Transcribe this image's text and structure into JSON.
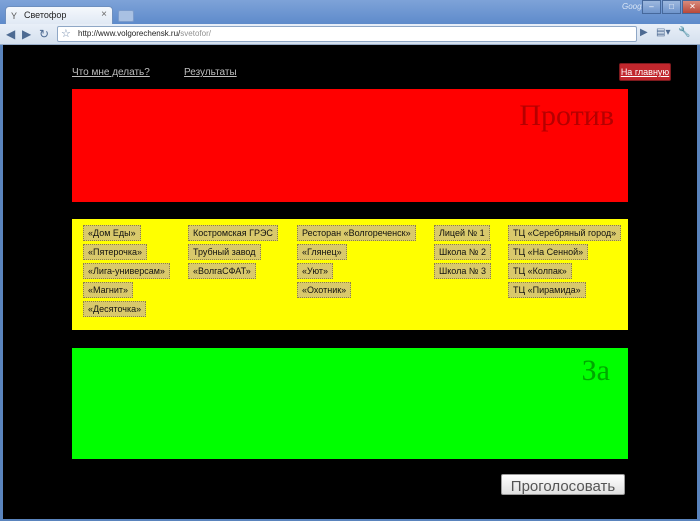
{
  "browser": {
    "tab_title": "Светофор",
    "brand": "Google",
    "url_host": "http://www.volgorechensk.ru/",
    "url_path": "svetofor/"
  },
  "nav": {
    "what_to_do": "Что мне делать?",
    "results": "Результаты",
    "home": "На главную"
  },
  "against": {
    "label": "Против"
  },
  "for": {
    "label": "За"
  },
  "options": {
    "col1": [
      "«Дом Еды»",
      "«Пятерочка»",
      "«Лига-универсам»",
      "«Магнит»",
      "«Десяточка»"
    ],
    "col2": [
      "Костромская ГРЭС",
      "Трубный завод",
      "«ВолгаСФАТ»"
    ],
    "col3": [
      "Ресторан «Волгореченск»",
      "«Глянец»",
      "«Уют»",
      "«Охотник»"
    ],
    "col4": [
      "Лицей № 1",
      "Школа № 2",
      "Школа № 3"
    ],
    "col5": [
      "ТЦ «Серебряный город»",
      "ТЦ «На Сенной»",
      "ТЦ «Колпак»",
      "ТЦ «Пирамида»"
    ]
  },
  "vote_button": "Проголосовать",
  "colors": {
    "against": "#ff0000",
    "neutral": "#ffff00",
    "for": "#00ff00",
    "home_button": "#c1272d"
  }
}
